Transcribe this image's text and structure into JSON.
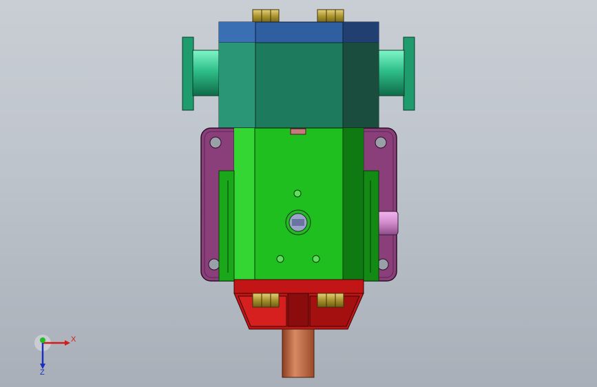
{
  "viewport": {
    "background_top": "#c9ced5",
    "background_bottom": "#a9afb8"
  },
  "model": {
    "colors": {
      "top_block": "#2f5fa0",
      "upper_body": "#1e7a5c",
      "side_flanges": "#2fbf8a",
      "main_body": "#1fbf1f",
      "side_plate": "#8a3f7a",
      "bottom_housing": "#c21616",
      "shaft": "#c8704a",
      "nuts": "#b8a23a",
      "side_pin": "#d58ad0"
    }
  },
  "triad": {
    "x_label": "X",
    "y_label": "Y",
    "z_label": "Z",
    "x_color": "#d21b1b",
    "y_color": "#1fbf1f",
    "z_color": "#1b2fbf"
  }
}
